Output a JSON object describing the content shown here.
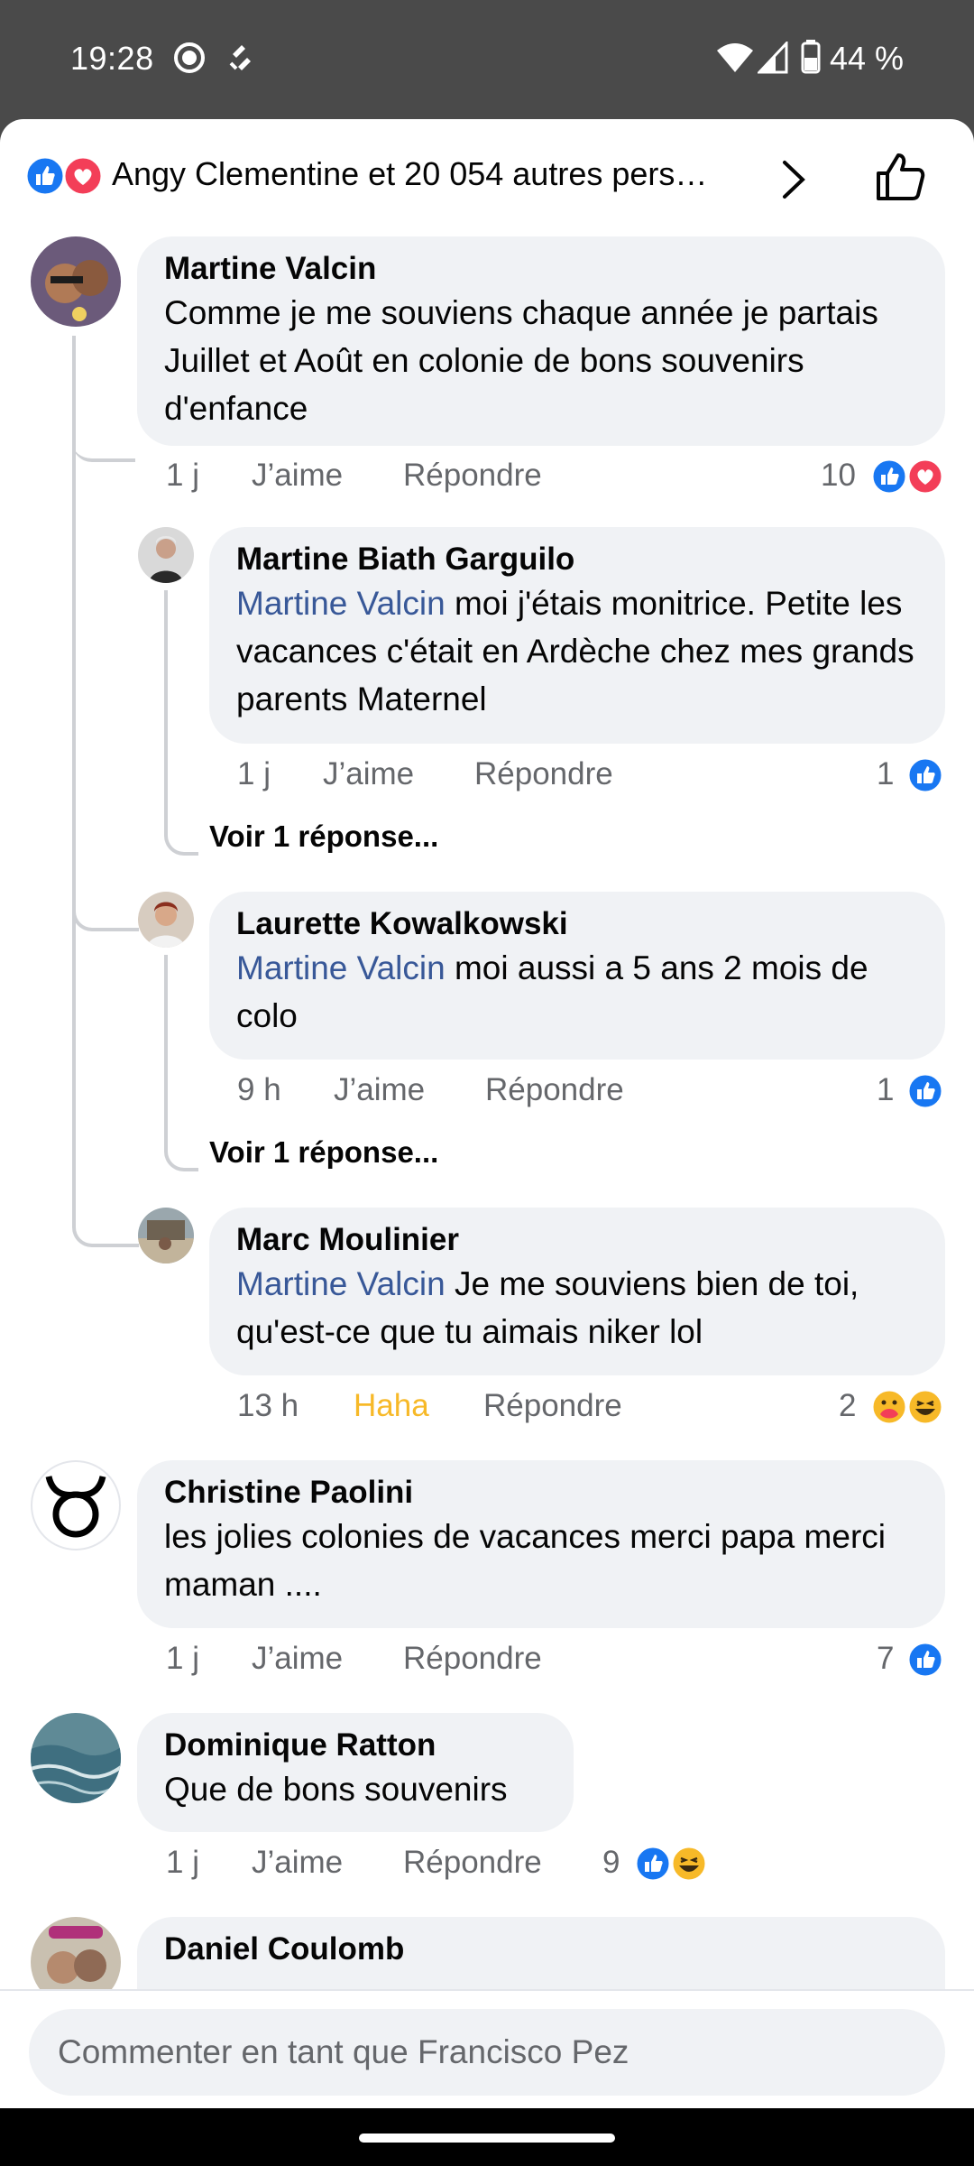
{
  "status_bar": {
    "time": "19:28",
    "battery": "44 %"
  },
  "header": {
    "reactors": "Angy Clementine et 20 054 autres pers…"
  },
  "comments": [
    {
      "author": "Martine Valcin",
      "text": "Comme je me souviens chaque année je partais Juillet et Août en colonie de bons souvenirs d'enfance",
      "time": "1 j",
      "like": "J’aime",
      "reply": "Répondre",
      "count": "10",
      "replies": [
        {
          "author": "Martine Biath Garguilo",
          "mention": "Martine Valcin",
          "text": " moi j'étais monitrice. Petite les vacances c'était en Ardèche chez mes grands parents Maternel",
          "time": "1 j",
          "like": "J’aime",
          "reply": "Répondre",
          "count": "1",
          "see_replies": "Voir 1 réponse..."
        },
        {
          "author": "Laurette Kowalkowski",
          "mention": "Martine Valcin",
          "text": " moi aussi a 5 ans 2 mois de colo",
          "time": "9 h",
          "like": "J’aime",
          "reply": "Répondre",
          "count": "1",
          "see_replies": "Voir 1 réponse..."
        },
        {
          "author": "Marc Moulinier",
          "mention": "Martine Valcin",
          "text": "  Je me souviens bien de toi, qu'est-ce que tu aimais niker lol",
          "time": "13 h",
          "like": "Haha",
          "reply": "Répondre",
          "count": "2"
        }
      ]
    },
    {
      "author": "Christine Paolini",
      "text": "les jolies colonies  de vacances merci papa merci maman ....",
      "time": "1 j",
      "like": "J’aime",
      "reply": "Répondre",
      "count": "7"
    },
    {
      "author": "Dominique Ratton",
      "text": "Que de bons souvenirs",
      "time": "1 j",
      "like": "J’aime",
      "reply": "Répondre",
      "count": "9"
    },
    {
      "author": "Daniel Coulomb"
    }
  ],
  "composer": {
    "placeholder": "Commenter en tant que Francisco Pez"
  },
  "colors": {
    "like_blue": "#1877f2",
    "love_red": "#f33e58",
    "haha_yellow": "#f7b928",
    "mention": "#385898",
    "bubble": "#f0f2f5"
  },
  "icons": [
    "like-icon",
    "love-icon",
    "haha-icon",
    "care-icon",
    "chevron-right-icon",
    "thumbs-up-outline-icon",
    "wifi-icon",
    "signal-icon",
    "battery-icon",
    "messenger-status-icon",
    "sync-status-icon",
    "taurus-icon"
  ]
}
